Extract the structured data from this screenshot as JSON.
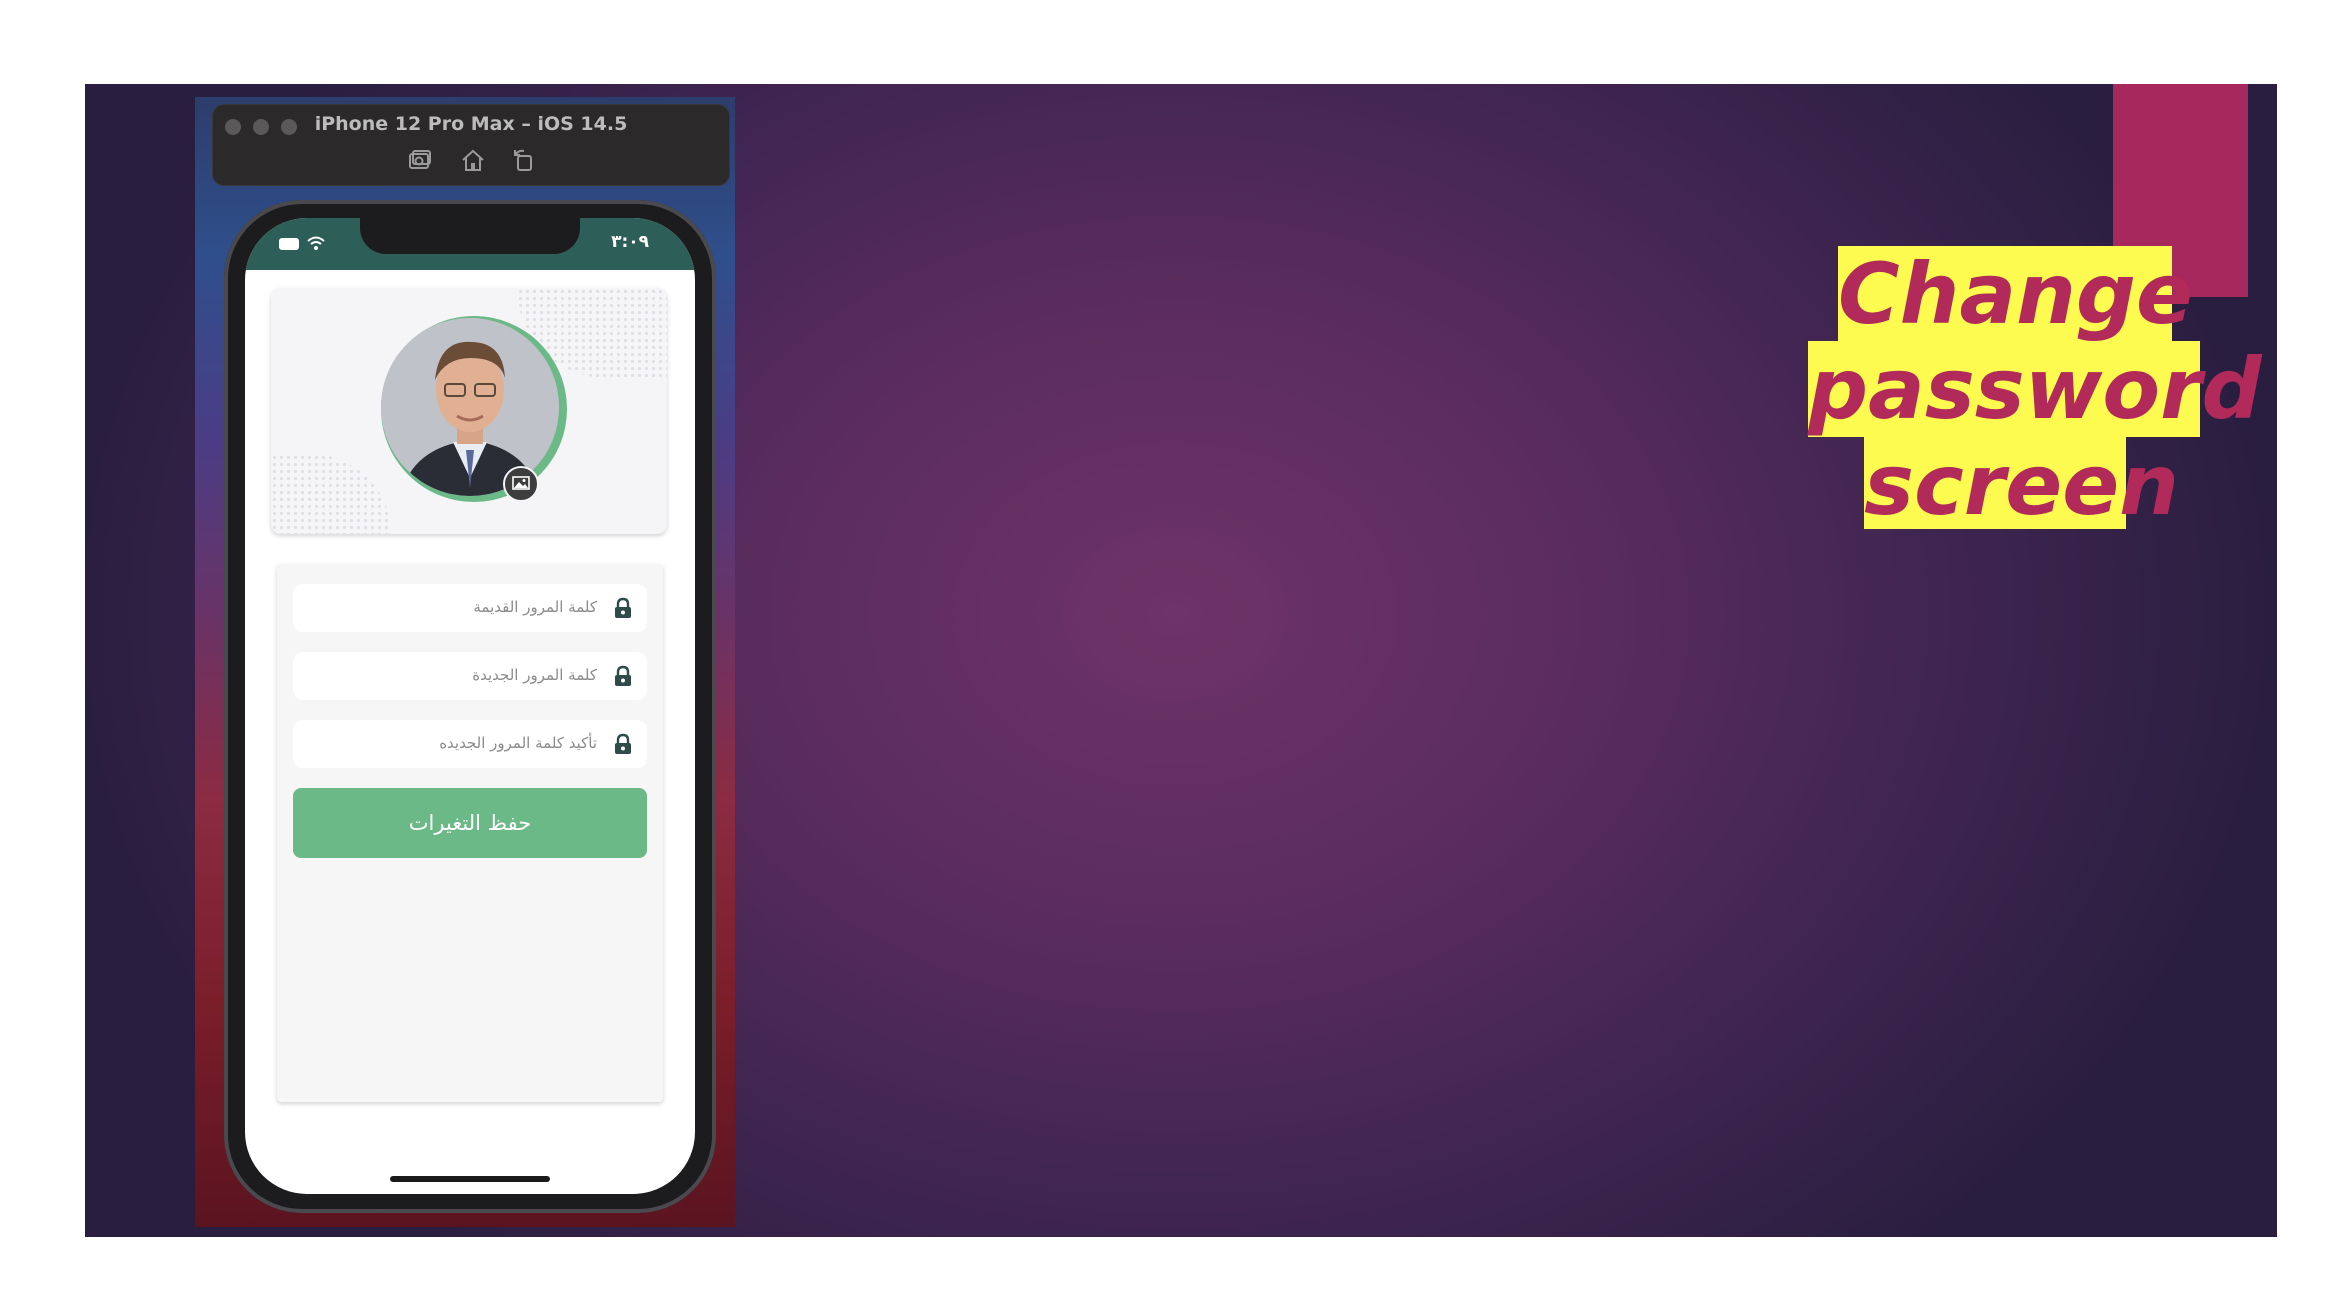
{
  "slide": {
    "title_lines": [
      "Change",
      "password",
      "screen"
    ],
    "colors": {
      "accent": "#a6285d",
      "title_text": "#b12a5a",
      "highlight": "#fdfb4f"
    }
  },
  "simulator": {
    "window_title": "iPhone 12 Pro Max – iOS 14.5",
    "toolbar_icons": [
      "screenshot-icon",
      "home-icon",
      "rotate-icon"
    ]
  },
  "phone": {
    "status_time": "٣:٠٩",
    "status_icons": [
      "battery-icon",
      "wifi-icon"
    ],
    "profile": {
      "avatar": "profile-photo",
      "badge_icon": "image-icon"
    },
    "form": {
      "fields": [
        {
          "placeholder": "كلمة المرور القديمة",
          "icon": "lock-icon"
        },
        {
          "placeholder": "كلمة المرور الجديدة",
          "icon": "lock-icon"
        },
        {
          "placeholder": "تأكيد كلمة المرور الجديده",
          "icon": "lock-icon"
        }
      ],
      "save_label": "حفظ التغيرات"
    },
    "colors": {
      "primary": "#6bb986",
      "status_bar": "#2e5e58"
    }
  }
}
